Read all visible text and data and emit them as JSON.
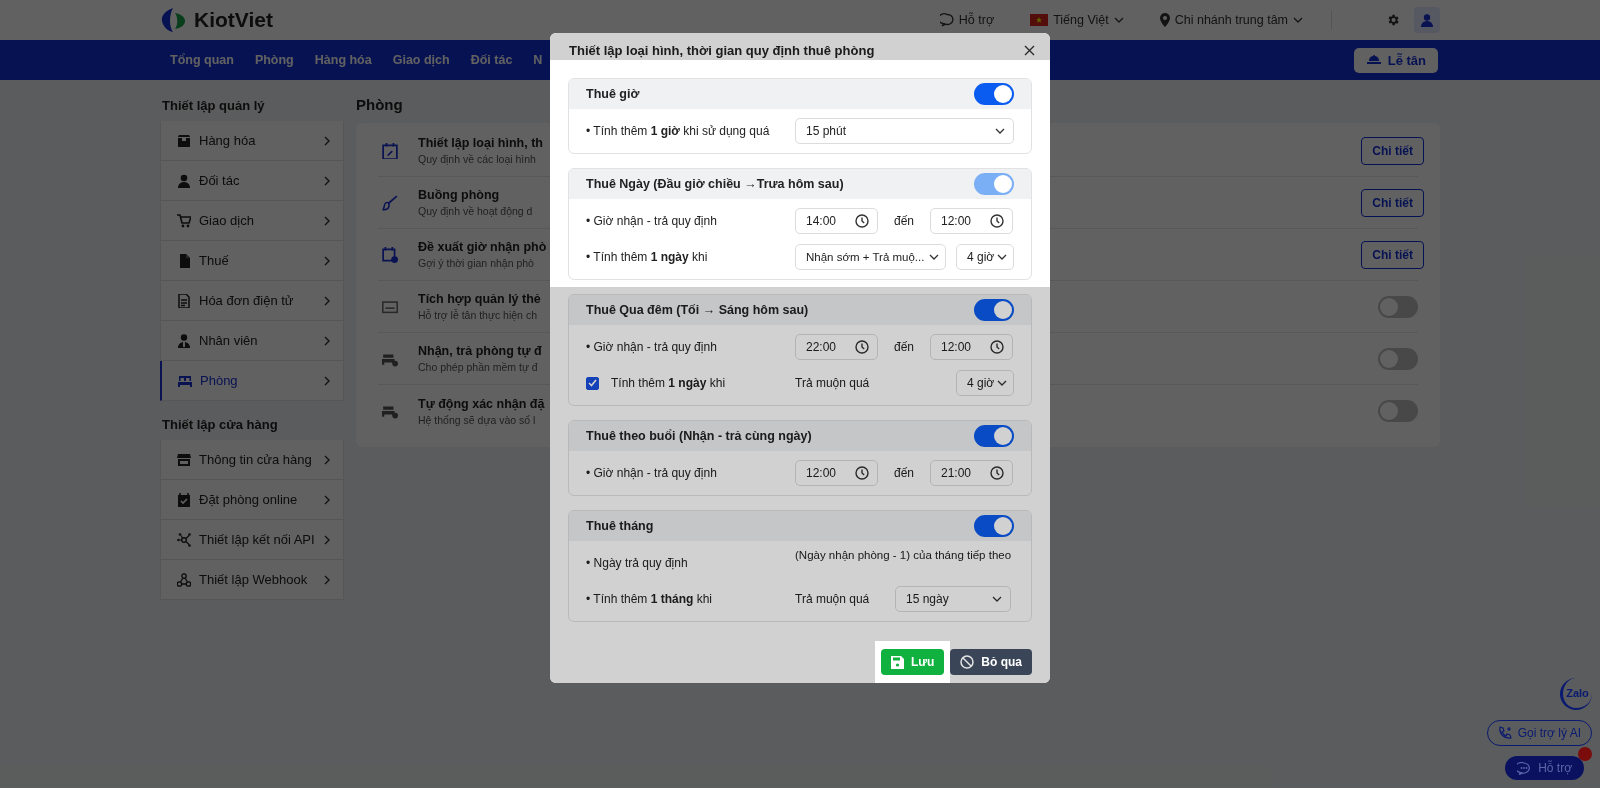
{
  "header": {
    "logo_text": "KiotViet",
    "support": "Hỗ trợ",
    "language": "Tiếng Việt",
    "branch": "Chi nhánh trung tâm"
  },
  "nav": {
    "items": [
      {
        "label": "Tổng quan",
        "selected": false
      },
      {
        "label": "Phòng",
        "selected": false
      },
      {
        "label": "Hàng hóa",
        "selected": false
      },
      {
        "label": "Giao dịch",
        "selected": false
      },
      {
        "label": "Đối tác",
        "selected": false
      },
      {
        "label": "N",
        "selected": false
      }
    ],
    "reception_button": "Lễ tân"
  },
  "sidebar": {
    "groups": [
      {
        "title": "Thiết lập quản lý",
        "items": [
          {
            "label": "Hàng hóa",
            "selected": false
          },
          {
            "label": "Đối tác",
            "selected": false
          },
          {
            "label": "Giao dịch",
            "selected": false
          },
          {
            "label": "Thuế",
            "selected": false
          },
          {
            "label": "Hóa đơn điện tử",
            "selected": false
          },
          {
            "label": "Nhân viên",
            "selected": false
          },
          {
            "label": "Phòng",
            "selected": true
          }
        ]
      },
      {
        "title": "Thiết lập cửa hàng",
        "items": [
          {
            "label": "Thông tin cửa hàng",
            "selected": false
          },
          {
            "label": "Đặt phòng online",
            "selected": false
          },
          {
            "label": "Thiết lập kết nối API",
            "selected": false
          },
          {
            "label": "Thiết lập Webhook",
            "selected": false
          }
        ]
      }
    ]
  },
  "main": {
    "title": "Phòng",
    "rows": [
      {
        "title": "Thiết lập loại hình, th",
        "description": "Quy định về các loại hình",
        "kind": "button",
        "button": "Chi tiết"
      },
      {
        "title": "Buồng phòng",
        "description": "Quy định về hoạt động d",
        "kind": "button",
        "button": "Chi tiết"
      },
      {
        "title": "Đề xuất giờ nhận phò",
        "description": "Gợi ý thời gian nhận phò",
        "kind": "button",
        "button": "Chi tiết"
      },
      {
        "title": "Tích hợp quản lý thẻ",
        "description": "Hỗ trợ lễ tân thực hiện ch",
        "kind": "toggle",
        "on": false
      },
      {
        "title": "Nhận, trả phòng tự đ",
        "description": "Cho phép phần mềm tự đ",
        "kind": "toggle",
        "on": false
      },
      {
        "title": "Tự động xác nhận đặ",
        "description": "Hệ thống sẽ dựa vào số l",
        "kind": "toggle",
        "on": false
      }
    ]
  },
  "modal": {
    "title": "Thiết lập loại hình, thời gian quy định thuê phòng",
    "sections": [
      {
        "title": "Thuê giờ",
        "toggle": {
          "on": true,
          "disabled": false
        },
        "highlighted": true,
        "rows": [
          {
            "kind": "select",
            "label": "• Tính thêm **1 giờ** khi sử dụng quá",
            "value": "15 phút"
          }
        ]
      },
      {
        "title": "Thuê Ngày (Đầu giờ chiều →Trưa hôm sau)",
        "toggle": {
          "on": true,
          "disabled": true
        },
        "highlighted": true,
        "rows": [
          {
            "kind": "time_range",
            "label": "• Giờ nhận - trả quy định",
            "from": "14:00",
            "separator": "đến",
            "to": "12:00"
          },
          {
            "kind": "select_pair",
            "label": "• Tính thêm **1 ngày** khi",
            "value": "Nhận sớm + Trả muộ...",
            "value2": "4 giờ"
          }
        ]
      },
      {
        "title": "Thuê Qua đêm (Tối → Sáng hôm sau)",
        "toggle": {
          "on": true,
          "disabled": false
        },
        "highlighted": false,
        "rows": [
          {
            "kind": "time_range",
            "label": "• Giờ nhận - trả quy định",
            "from": "22:00",
            "separator": "đến",
            "to": "12:00"
          },
          {
            "kind": "checkbox_select",
            "checked": true,
            "label": "Tính thêm **1 ngày** khi",
            "condition": "Trả muộn quá",
            "value": "4 giờ"
          }
        ]
      },
      {
        "title": "Thuê theo buổi (Nhận - trả cùng ngày)",
        "toggle": {
          "on": true,
          "disabled": false
        },
        "highlighted": false,
        "rows": [
          {
            "kind": "time_range",
            "label": "• Giờ nhận - trả quy định",
            "from": "12:00",
            "separator": "đến",
            "to": "21:00"
          }
        ]
      },
      {
        "title": "Thuê tháng",
        "toggle": {
          "on": true,
          "disabled": false
        },
        "highlighted": false,
        "rows": [
          {
            "kind": "text",
            "label": "• Ngày trả quy định",
            "value": "(Ngày nhận phòng - 1) của tháng tiếp theo"
          },
          {
            "kind": "condition_select",
            "label": "• Tính thêm **1 tháng** khi",
            "condition": "Trả muộn quá",
            "value": "15 ngày"
          }
        ]
      }
    ],
    "save_button": {
      "label": "Lưu",
      "highlighted": true
    },
    "cancel_button": "Bỏ qua"
  },
  "floating": {
    "zalo": "Zalo",
    "ai_button": "Gọi trợ lý AI",
    "support_button": {
      "label": "Hỗ trợ",
      "has_notification": true
    }
  }
}
